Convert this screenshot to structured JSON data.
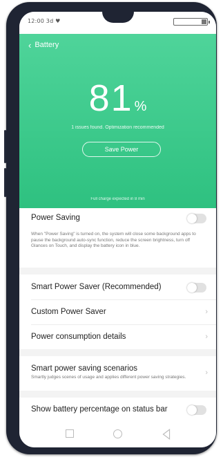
{
  "status_bar": {
    "time": "12:00 3d ♥",
    "battery_level": 0.15
  },
  "header": {
    "back_label": "Battery"
  },
  "battery": {
    "percent": "81",
    "percent_sign": "%",
    "issue_text": "1 issues found. Optimization recommended",
    "save_power_label": "Save Power",
    "full_charge_text": "Full charge expected in 8 min"
  },
  "power_saving": {
    "title": "Power Saving",
    "description": "When \"Power Saving\" is turned on, the system will close some background apps to pause the background auto-sync function, reduce the screen brightness, turn off Glances on Touch, and display the battery icon in blue.",
    "enabled": false
  },
  "menu": {
    "smart_saver": {
      "label": "Smart Power Saver (Recommended)",
      "enabled": false
    },
    "custom_saver": {
      "label": "Custom Power Saver"
    },
    "consumption": {
      "label": "Power consumption details"
    },
    "scenarios": {
      "label": "Smart power saving scenarios",
      "description": "Smartly judges scenes of usage and applies different power saving strategies."
    },
    "show_percentage": {
      "label": "Show battery percentage on status bar",
      "enabled": false
    }
  },
  "icons": {
    "back": "chevron-left-icon",
    "arrow": "chevron-right-icon",
    "nav_recent": "square-icon",
    "nav_home": "circle-icon",
    "nav_back": "triangle-icon"
  },
  "colors": {
    "hero_top": "#4fd49a",
    "hero_bottom": "#2ec180",
    "phone_frame": "#1f2433"
  }
}
